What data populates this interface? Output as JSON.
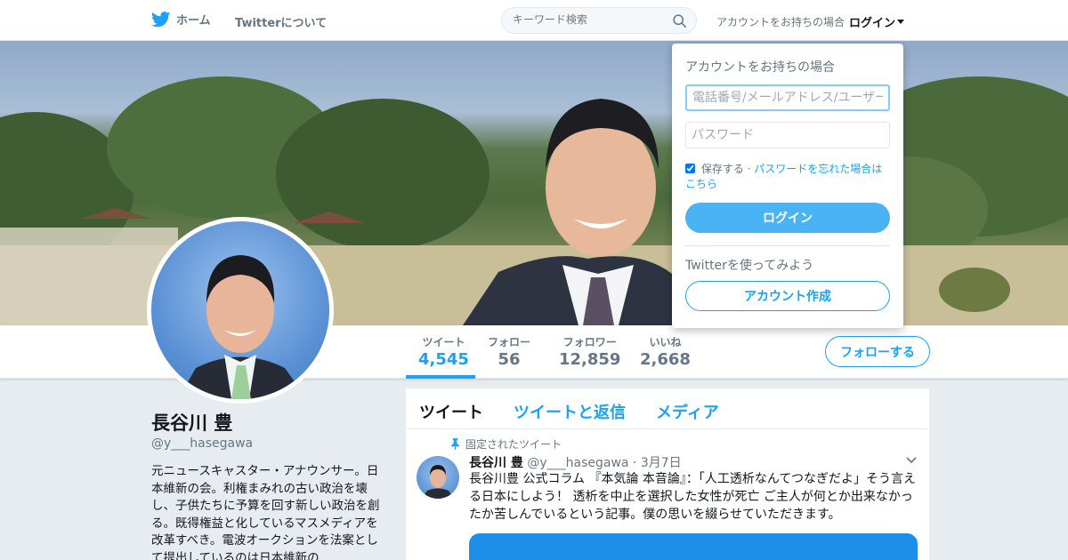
{
  "nav": {
    "home_label": "ホーム",
    "about_label": "Twitterについて",
    "search_placeholder": "キーワード検索",
    "login_prompt": "アカウントをお持ちの場合",
    "login_label": "ログイン"
  },
  "profile_nav": {
    "stats": [
      {
        "label": "ツイート",
        "value": "4,545"
      },
      {
        "label": "フォロー",
        "value": "56"
      },
      {
        "label": "フォロワー",
        "value": "12,859"
      },
      {
        "label": "いいね",
        "value": "2,668"
      }
    ],
    "follow_label": "フォローする"
  },
  "profile": {
    "name": "長谷川 豊",
    "handle": "@y___hasegawa",
    "bio": "元ニュースキャスター・アナウンサー。日本維新の会。利権まみれの古い政治を壊し、子供たちに予算を回す新しい政治を創る。既得権益と化しているマスメディアを改革すべき。電波オークションを法案として提出しているのは日本維新の"
  },
  "timeline": {
    "tabs": [
      "ツイート",
      "ツイートと返信",
      "メディア"
    ],
    "pinned_label": "固定されたツイート",
    "tweet": {
      "name": "長谷川 豊",
      "handle": "@y___hasegawa",
      "date": "· 3月7日",
      "text": "長谷川豊 公式コラム 『本気論 本音論』：「人工透析なんてつなぎだよ」そう言える日本にしよう！ 透析を中止を選択した女性が死亡 ご主人が何とか出来なかったか苦しんでいるという記事。僕の思いを綴らせていただきます。"
    }
  },
  "login_dropdown": {
    "title": "アカウントをお持ちの場合",
    "username_placeholder": "電話番号/メールアドレス/ユーザー名",
    "password_placeholder": "パスワード",
    "remember_label": "保存する",
    "forgot_label": "· パスワードを忘れた場合はこちら",
    "login_button": "ログイン",
    "try_label": "Twitterを使ってみよう",
    "signup_button": "アカウント作成"
  },
  "colors": {
    "accent": "#1da1f2",
    "login_button": "#4ab3f4"
  }
}
